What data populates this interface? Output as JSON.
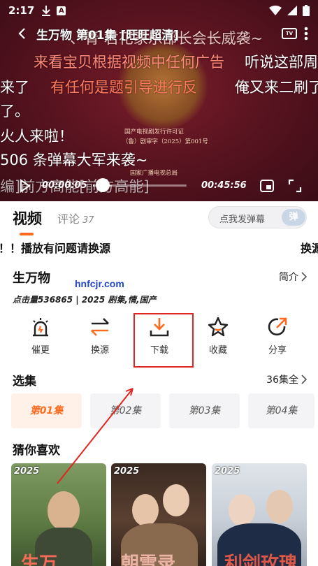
{
  "status_bar": {
    "time": "2:17",
    "icons": [
      "download-icon",
      "a-icon",
      "wifi-icon",
      "signal-icon",
      "battery-icon"
    ]
  },
  "player": {
    "title": "生万物 第01集 [旺旺超清]",
    "current_time": "00:00:05",
    "total_time": "00:45:56",
    "progress": 0.002,
    "seal_lines": [
      "国产电视剧发行许可证",
      "（鲁）剧审字（2025）第001号",
      "国家广播电视总局"
    ],
    "danmaku": [
      "、青 君花家乐部长会长威袭~",
      "来看宝贝根据视频中任何广告",
      "听说这部周",
      "来了",
      "有任何是题引导进行反",
      "俺又来二刷了",
      "了。",
      "火人来啦！",
      "506 条弹幕大军来袭~",
      "编]前方高能[前方高能]"
    ]
  },
  "tabs": {
    "video": "视频",
    "comment": "评论",
    "comment_count": "37",
    "danmu_button": "点我发弹幕",
    "danmu_toggle": "弹"
  },
  "notice": {
    "text1": "！！播放有问题请换源",
    "text2": "换源"
  },
  "info": {
    "title": "生万物",
    "intro_label": "简介",
    "meta": "点击量536865 | 2025 剧集,情,国产",
    "watermark": "hnfcjr.com"
  },
  "actions": [
    {
      "label": "催更",
      "icon": "alarm-icon"
    },
    {
      "label": "换源",
      "icon": "swap-icon"
    },
    {
      "label": "下载",
      "icon": "download-icon"
    },
    {
      "label": "收藏",
      "icon": "star-icon"
    },
    {
      "label": "分享",
      "icon": "share-icon"
    }
  ],
  "episodes": {
    "title": "选集",
    "total_label": "36集全",
    "items": [
      {
        "label": "第01集",
        "active": true
      },
      {
        "label": "第02集",
        "active": false
      },
      {
        "label": "第03集",
        "active": false
      },
      {
        "label": "第04集",
        "active": false
      }
    ]
  },
  "recommendations": {
    "title": "猜你喜欢",
    "items": [
      {
        "year": "2025",
        "title": "生万"
      },
      {
        "year": "2025",
        "title": "朝雪录"
      },
      {
        "year": "2025",
        "title": "利剑玫瑰"
      }
    ]
  },
  "colors": {
    "accent": "#ff6a1f",
    "highlight_box": "#e0261e",
    "video_bg": "#5a1420"
  }
}
